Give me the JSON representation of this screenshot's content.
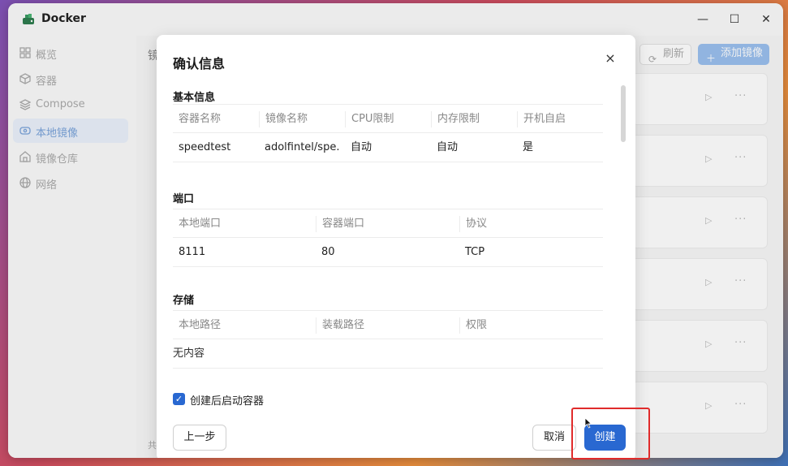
{
  "window": {
    "title": "Docker"
  },
  "window_controls": {
    "minimize": "—",
    "maximize": "☐",
    "close": "✕"
  },
  "sidebar": {
    "items": [
      {
        "label": "概览",
        "icon": "grid-icon",
        "active": false
      },
      {
        "label": "容器",
        "icon": "box-icon",
        "active": false
      },
      {
        "label": "Compose",
        "icon": "layers-icon",
        "active": false
      },
      {
        "label": "本地镜像",
        "icon": "disk-icon",
        "active": true
      },
      {
        "label": "镜像仓库",
        "icon": "home-icon",
        "active": false
      },
      {
        "label": "网络",
        "icon": "globe-icon",
        "active": false
      }
    ]
  },
  "main": {
    "crumb": "镜",
    "refresh_label": "刷新",
    "add_label": "添加镜像",
    "footer_text": "共"
  },
  "dialog": {
    "title": "确认信息",
    "close_glyph": "×",
    "basic": {
      "title": "基本信息",
      "headers": [
        "容器名称",
        "镜像名称",
        "CPU限制",
        "内存限制",
        "开机自启"
      ],
      "values": [
        "speedtest",
        "adolfintel/spe...",
        "自动",
        "自动",
        "是"
      ]
    },
    "ports": {
      "title": "端口",
      "headers": [
        "本地端口",
        "容器端口",
        "协议"
      ],
      "values": [
        "8111",
        "80",
        "TCP"
      ]
    },
    "storage": {
      "title": "存储",
      "headers": [
        "本地路径",
        "装载路径",
        "权限"
      ],
      "empty_text": "无内容"
    },
    "checkbox_label": "创建后启动容器",
    "checkbox_checked": true,
    "prev_label": "上一步",
    "cancel_label": "取消",
    "create_label": "创建"
  },
  "colors": {
    "primary": "#2968d1",
    "highlight": "#e02b2b",
    "active_nav": "#7aa3da"
  }
}
